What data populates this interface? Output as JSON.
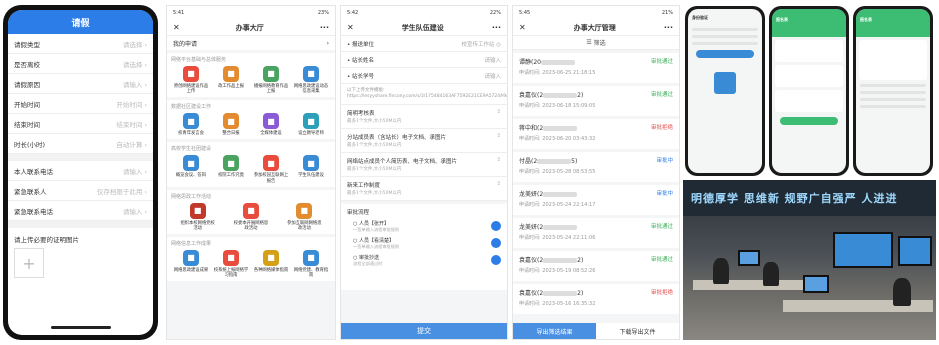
{
  "panel1": {
    "title": "请假",
    "rows": [
      {
        "label": "请假类型",
        "ph": "请选择"
      },
      {
        "label": "是否离校",
        "ph": "请选择"
      },
      {
        "label": "请假原因",
        "ph": "请输入"
      },
      {
        "label": "开始时间",
        "ph": "开始时间"
      },
      {
        "label": "结束时间",
        "ph": "结束时间"
      },
      {
        "label": "时长(小时)",
        "ph": "自动计算"
      },
      {
        "label": "本人联系电话",
        "ph": "请输入"
      },
      {
        "label": "紧急联系人",
        "ph": "仅存档限于此用"
      },
      {
        "label": "紧急联系电话",
        "ph": "请输入"
      }
    ],
    "upload_label": "请上传必要的证明图片",
    "plus": "+"
  },
  "panel2": {
    "status_time": "5:41",
    "status_batt": "23%",
    "title": "办事大厅",
    "my_apps": "我的申请",
    "sections": [
      {
        "h": "网络平台基础与总体服务",
        "items": [
          "原创网络建设作品上传",
          "政工作品上报",
          "播报网络教育作品上报",
          "网络思政建设动态信息采集"
        ],
        "colors": [
          "#e94b3c",
          "#e38b2f",
          "#4aa360",
          "#3a8bd6"
        ]
      },
      {
        "h": "数据社区建设工作",
        "items": [
          "校青年发言会",
          "整合日报",
          "全媒体建设",
          "设立教导老师"
        ],
        "colors": [
          "#3a8bd6",
          "#e38b2f",
          "#8a5bd6",
          "#2ca0b8"
        ]
      },
      {
        "h": "高校学生社团建设",
        "items": [
          "概览会议、答辩",
          "校院工作究竟",
          "参加校园互联网上报告",
          "学生队伍建设"
        ],
        "colors": [
          "#3a8bd6",
          "#4aa360",
          "#e94b3c",
          "#3a8bd6"
        ]
      },
      {
        "h": "网络思政工作活动",
        "items": [
          "组织本校网络党校活动",
          "校委本开展网络思政活动",
          "参加互联网网络思政活动"
        ],
        "colors": [
          "#c0392b",
          "#e94b3c",
          "#e38b2f"
        ]
      },
      {
        "h": "网络信息工作成果",
        "items": [
          "网络思政建设成果",
          "校系统上报网络学习指南",
          "各种网络媒体指南",
          "网络党建、教育指南"
        ],
        "colors": [
          "#3a8bd6",
          "#e94b3c",
          "#d4a017",
          "#3a8bd6"
        ]
      }
    ]
  },
  "panel3": {
    "status_time": "5:42",
    "status_batt": "22%",
    "title": "学生队伍建设",
    "fields": [
      {
        "label": "• 报送单位",
        "value": "校宣传工作站 ◎"
      },
      {
        "label": "• 站长姓名",
        "value": "请输入"
      },
      {
        "label": "• 站长学号",
        "value": "请输入"
      }
    ],
    "note": "以下上传文件模板: https://lesyyshare.fincony.com/s/3/175484163AF7592E21CE9A5724A9AD3BE",
    "attachments": [
      {
        "t": "简明考核表",
        "s": "最多1个文件,大小50M以内"
      },
      {
        "t": "分站成员表（含站长）电子文档、承图片",
        "s": "最多1个文件,大小50M以内"
      },
      {
        "t": "网络站点成员个人简历表、电子文档、承图片",
        "s": "最多1个文件,大小50M以内"
      },
      {
        "t": "新来工作制度",
        "s": "最多1个文件,大小50M以内"
      }
    ],
    "flow_title": "审批流程",
    "flow": [
      {
        "t": "人员【张开】",
        "s": "一签单输入流程审批规则"
      },
      {
        "t": "人员【看清楚】",
        "s": "一签单输入流程审批规则"
      },
      {
        "t": "审批抄送",
        "s": "流程全部通过时"
      }
    ],
    "submit": "提交"
  },
  "panel4": {
    "status_time": "5:45",
    "status_batt": "21%",
    "title": "办事大厅管理",
    "filter": "筛选",
    "records": [
      {
        "name": "谭静(20",
        "tail": "",
        "status": "审批通过",
        "cls": "ok",
        "time": "申请时间: 2023-06-25 21:18:15"
      },
      {
        "name": "袁嘉仪(2",
        "tail": "2)",
        "status": "审批通过",
        "cls": "ok",
        "time": "申请时间: 2023-06-18 15:09:05"
      },
      {
        "name": "蒋中和(2",
        "tail": "",
        "status": "审批拒绝",
        "cls": "no",
        "time": "申请时间: 2023-06-20 03:43:32"
      },
      {
        "name": "付晶(2",
        "tail": "5)",
        "status": "审批中",
        "cls": "wait",
        "time": "申请时间: 2023-05-28 08:53:55"
      },
      {
        "name": "龙美妍(2",
        "tail": "",
        "status": "审批中",
        "cls": "wait",
        "time": "申请时间: 2023-05-24 22:14:17"
      },
      {
        "name": "龙美妍(2",
        "tail": "",
        "status": "审批通过",
        "cls": "ok",
        "time": "申请时间: 2023-05-24 22:11:06"
      },
      {
        "name": "袁嘉仪(2",
        "tail": "2)",
        "status": "审批通过",
        "cls": "ok",
        "time": "申请时间: 2023-05-19 08:52:26"
      },
      {
        "name": "袁嘉仪(2",
        "tail": "2)",
        "status": "审批拒绝",
        "cls": "no",
        "time": "申请时间: 2023-05-16 16:35:32"
      }
    ],
    "export_filtered": "导出筛选结果",
    "download_file": "下载导出文件"
  },
  "panel5": {
    "phone1_title": "身份验证",
    "phone2_title": "报名表",
    "phone3_title": "报名表"
  },
  "photo": {
    "banner": "明德厚学 思维新 规野广自强严 人进进"
  }
}
